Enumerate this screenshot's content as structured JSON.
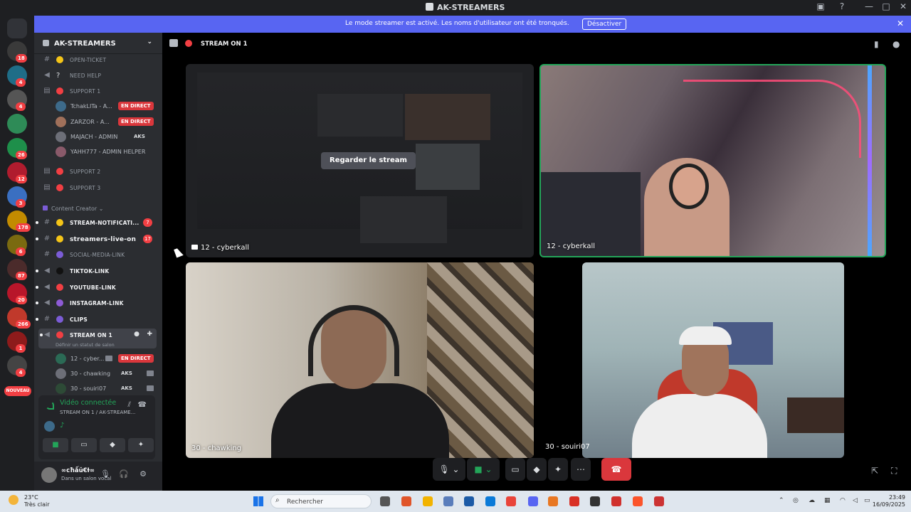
{
  "window": {
    "title": "AK-STREAMERS",
    "controls": [
      "—",
      "□",
      "✕"
    ]
  },
  "banner": {
    "message": "Le mode streamer est activé. Les noms d'utilisateur ont été tronqués.",
    "button": "Désactiver"
  },
  "guilds": [
    {
      "badge": "18",
      "color": "#3a3a3a"
    },
    {
      "badge": "4",
      "color": "#1f6d87"
    },
    {
      "badge": "4",
      "color": "#555555"
    },
    {
      "badge": "",
      "color": "#2e8b57"
    },
    {
      "badge": "26",
      "color": "#1e8f4a"
    },
    {
      "badge": "12",
      "color": "#b01c2e"
    },
    {
      "badge": "3",
      "color": "#3a6fc1"
    },
    {
      "badge": "178",
      "color": "#c28b00"
    },
    {
      "badge": "6",
      "color": "#7a6a10"
    },
    {
      "badge": "87",
      "color": "#4b2b2b"
    },
    {
      "badge": "20",
      "color": "#b8162a"
    },
    {
      "badge": "266",
      "color": "#c0392b"
    },
    {
      "badge": "1",
      "color": "#8e1b1b"
    },
    {
      "badge": "4",
      "color": "#444444"
    }
  ],
  "new_badge": "NOUVEAU",
  "sidebar": {
    "server_name": "AK-STREAMERS",
    "channels_top": [
      {
        "label": "OPEN-TICKET",
        "icon": "#",
        "bold": false
      },
      {
        "label": "NEED HELP",
        "icon": "◀",
        "bold": false
      },
      {
        "label": "SUPPORT 1",
        "icon": "🔒",
        "bold": false
      }
    ],
    "support1_users": [
      {
        "name": "TchakLITa - A...",
        "live": "EN DIRECT"
      },
      {
        "name": "ZARZOR - A...",
        "live": "EN DIRECT"
      },
      {
        "name": "MAJACH - ADMIN",
        "tag": "AKS"
      },
      {
        "name": "YAHH777 - ADMIN HELPER"
      }
    ],
    "channels_mid": [
      {
        "label": "SUPPORT 2",
        "icon": "🔒"
      },
      {
        "label": "SUPPORT 3",
        "icon": "🔒"
      }
    ],
    "category": "Content Creator",
    "channels_cc": [
      {
        "label": "STREAM-NOTIFICATI...",
        "icon": "#",
        "emoji": "#f5c518",
        "count": "7",
        "bold": true
      },
      {
        "label": "streamers-live-on",
        "icon": "#",
        "emoji": "#f5c518",
        "count": "17",
        "bold": true
      },
      {
        "label": "SOCIAL-MEDIA-LINK",
        "icon": "#",
        "emoji": "#7b5cd6",
        "bold": false
      },
      {
        "label": "TIKTOK-LINK",
        "icon": "◀",
        "emoji": "#111111",
        "bold": true
      },
      {
        "label": "YOUTUBE-LINK",
        "icon": "◀",
        "emoji": "#f23f43",
        "bold": true
      },
      {
        "label": "INSTAGRAM-LINK",
        "icon": "◀",
        "emoji": "#8e5bd6",
        "bold": true
      },
      {
        "label": "CLIPS",
        "icon": "#",
        "emoji": "#7b5cd6",
        "bold": true
      }
    ],
    "stream_channel": {
      "label": "STREAM ON 1",
      "status": "Définir un statut de salon"
    },
    "stream_users": [
      {
        "name": "12 - cyber...",
        "live": "EN DIRECT"
      },
      {
        "name": "30 - chawking",
        "tag": "AKS"
      },
      {
        "name": "30 - souiri07",
        "tag": "AKS"
      }
    ],
    "voice_panel": {
      "status": "Vidéo connectée",
      "sub": "STREAM ON 1 / AK-STREAME..."
    },
    "user": {
      "name": "∞cħǻŭ€Ɨ∞",
      "status": "Dans un salon vocal"
    }
  },
  "stage": {
    "channel": "STREAM ON 1",
    "watch_button": "Regarder le stream",
    "tiles": [
      {
        "label": "12 - cyberkall"
      },
      {
        "label": "12 - cyberkall"
      },
      {
        "label": "30 - chawking"
      },
      {
        "label": "30 - souiri07"
      }
    ]
  },
  "taskbar": {
    "temp": "23°C",
    "weather": "Très clair",
    "search_placeholder": "Rechercher",
    "time": "23:49",
    "date": "16/09/2025",
    "apps": [
      "#555",
      "#e0552a",
      "#f2b300",
      "#5a7dbb",
      "#1c5aa6",
      "#0a7ad8",
      "#e9443a",
      "#5865f2",
      "#e87722",
      "#d93025",
      "#333",
      "#d0312d",
      "#fb542b",
      "#c33"
    ]
  },
  "colors": {
    "accent": "#5865f2",
    "live": "#da373c",
    "connected": "#23a559"
  }
}
